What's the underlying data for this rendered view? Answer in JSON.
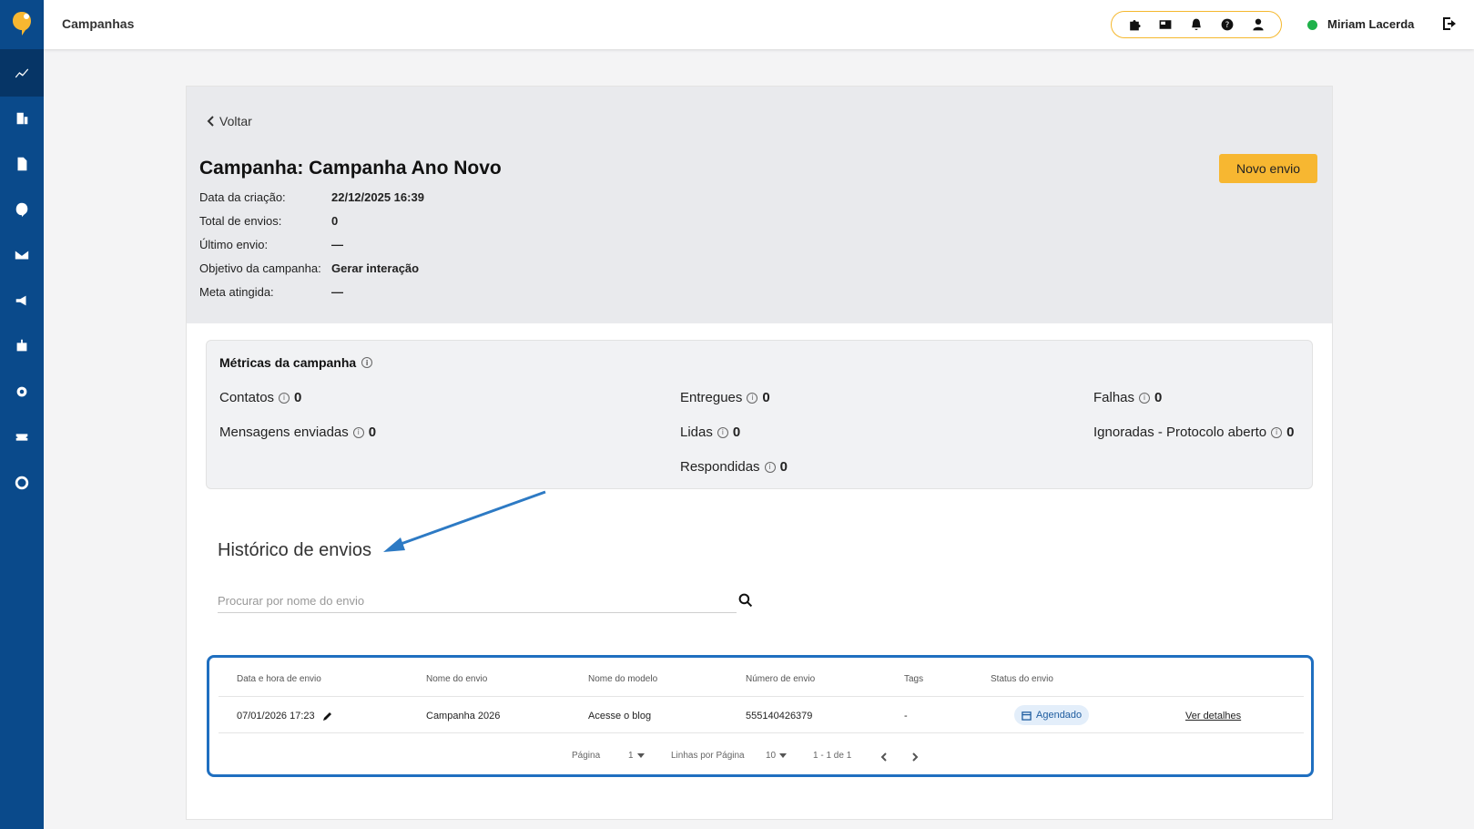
{
  "header": {
    "title": "Campanhas",
    "user_name": "Miriam Lacerda",
    "status_color": "#1fb14a",
    "toolbar_icons": [
      "puzzle-icon",
      "news-icon",
      "bell-icon",
      "help-icon",
      "user-icon"
    ]
  },
  "sidebar": {
    "items": [
      "dashboard-icon",
      "building-icon",
      "document-icon",
      "brand-icon",
      "mail-icon",
      "megaphone-icon",
      "bot-icon",
      "gear-icon",
      "ticket-icon",
      "nps-icon"
    ]
  },
  "campaign": {
    "back_label": "Voltar",
    "title": "Campanha: Campanha Ano Novo",
    "new_button": "Novo envio",
    "fields": [
      {
        "label": "Data da criação:",
        "value": "22/12/2025 16:39"
      },
      {
        "label": "Total de envios:",
        "value": "0"
      },
      {
        "label": "Último envio:",
        "value": "—"
      },
      {
        "label": "Objetivo da campanha:",
        "value": "Gerar interação"
      },
      {
        "label": "Meta atingida:",
        "value": "—"
      }
    ]
  },
  "metrics": {
    "title": "Métricas da campanha",
    "info_glyph": "i",
    "items": {
      "contatos": {
        "label": "Contatos",
        "value": "0"
      },
      "mensagens": {
        "label": "Mensagens enviadas",
        "value": "0"
      },
      "entregues": {
        "label": "Entregues",
        "value": "0"
      },
      "lidas": {
        "label": "Lidas",
        "value": "0"
      },
      "respondidas": {
        "label": "Respondidas",
        "value": "0"
      },
      "falhas": {
        "label": "Falhas",
        "value": "0"
      },
      "ignoradas": {
        "label": "Ignoradas - Protocolo aberto",
        "value": "0"
      }
    }
  },
  "history": {
    "title": "Histórico de envios",
    "search_placeholder": "Procurar por nome do envio",
    "columns": {
      "date": "Data e hora de envio",
      "name": "Nome do envio",
      "model": "Nome do modelo",
      "number": "Número de envio",
      "tags": "Tags",
      "status": "Status do envio"
    },
    "rows": [
      {
        "date": "07/01/2026 17:23",
        "name": "Campanha 2026",
        "model": "Acesse o blog",
        "number": "555140426379",
        "tags": "-",
        "status": "Agendado",
        "action": "Ver detalhes"
      }
    ],
    "pager": {
      "page_label": "Página",
      "page_value": "1",
      "rows_label": "Linhas por Página",
      "rows_value": "10",
      "range": "1 - 1 de 1"
    }
  },
  "colors": {
    "sidebar": "#0a4a8b",
    "accent": "#f7b731",
    "highlight": "#1f6fc0"
  }
}
